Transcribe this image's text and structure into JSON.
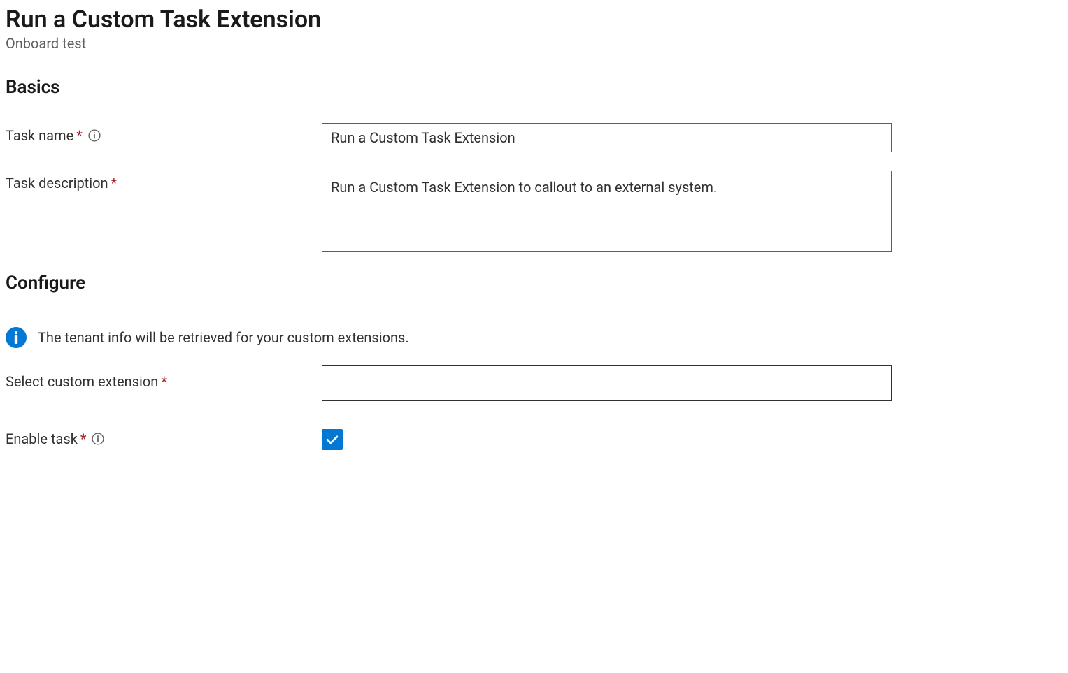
{
  "page": {
    "title": "Run a Custom Task Extension",
    "subtitle": "Onboard test"
  },
  "sections": {
    "basics": {
      "heading": "Basics"
    },
    "configure": {
      "heading": "Configure"
    }
  },
  "form": {
    "taskName": {
      "label": "Task name",
      "required": "*",
      "value": "Run a Custom Task Extension"
    },
    "taskDescription": {
      "label": "Task description",
      "required": "*",
      "value": "Run a Custom Task Extension to callout to an external system."
    },
    "tenantInfoMessage": "The tenant info will be retrieved for your custom extensions.",
    "selectExtension": {
      "label": "Select custom extension",
      "required": "*",
      "value": ""
    },
    "enableTask": {
      "label": "Enable task",
      "required": "*",
      "checked": true
    }
  },
  "colors": {
    "primary": "#0078d4",
    "required": "#a4262c",
    "textPrimary": "#323130",
    "textSecondary": "#605e5c",
    "border": "#605e5c"
  }
}
